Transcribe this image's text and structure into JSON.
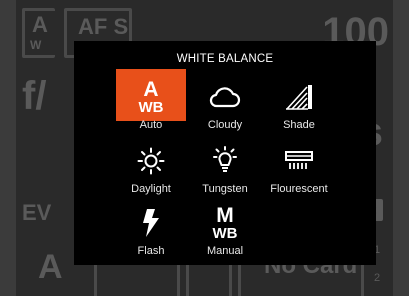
{
  "background": {
    "wb_letter": "A",
    "wb_sub": "W",
    "af_label": "AF S",
    "iso_value": "100",
    "aperture_label": "f/",
    "shutter_label": "s",
    "ev_label": "EV",
    "drive_label": "A",
    "card_label": "No Card",
    "slot1": "1",
    "slot2": "2"
  },
  "panel": {
    "title": "WHITE BALANCE",
    "accent_color": "#e8501a",
    "selected": "Auto",
    "options": [
      {
        "label": "Auto",
        "icon": "auto-wb-icon",
        "top_text": "A",
        "bottom_text": "WB"
      },
      {
        "label": "Cloudy",
        "icon": "cloud-icon"
      },
      {
        "label": "Shade",
        "icon": "shade-icon"
      },
      {
        "label": "Daylight",
        "icon": "sun-icon"
      },
      {
        "label": "Tungsten",
        "icon": "bulb-icon"
      },
      {
        "label": "Flourescent",
        "icon": "fluorescent-icon"
      },
      {
        "label": "Flash",
        "icon": "flash-icon"
      },
      {
        "label": "Manual",
        "icon": "manual-wb-icon",
        "top_text": "M",
        "bottom_text": "WB"
      }
    ]
  }
}
